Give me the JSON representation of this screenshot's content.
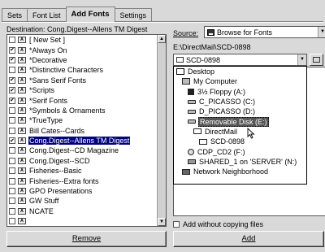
{
  "tabs": [
    "Sets",
    "Font List",
    "Add Fonts",
    "Settings"
  ],
  "active_tab": 2,
  "destination": {
    "label": "Destination: Cong.Digest--Allens TM Digest"
  },
  "font_sets": [
    {
      "label": "[ New Set ]",
      "checked": false,
      "selected": false
    },
    {
      "label": "*Always On",
      "checked": true,
      "selected": false
    },
    {
      "label": "*Decorative",
      "checked": true,
      "selected": false
    },
    {
      "label": "*Distinctive Characters",
      "checked": false,
      "selected": false
    },
    {
      "label": "*Sans Serif Fonts",
      "checked": true,
      "selected": false
    },
    {
      "label": "*Scripts",
      "checked": true,
      "selected": false
    },
    {
      "label": "*Serif Fonts",
      "checked": true,
      "selected": false
    },
    {
      "label": "*Symbols & Ornaments",
      "checked": false,
      "selected": false
    },
    {
      "label": "*TrueType",
      "checked": false,
      "selected": false
    },
    {
      "label": "Bill Cates--Cards",
      "checked": false,
      "selected": false
    },
    {
      "label": "Cong.Digest--Allens TM Digest",
      "checked": true,
      "selected": true
    },
    {
      "label": "Cong.Digest--CD Magazine",
      "checked": false,
      "selected": false
    },
    {
      "label": "Cong.Digest--SCD",
      "checked": false,
      "selected": false
    },
    {
      "label": "Fisheries--Basic",
      "checked": false,
      "selected": false
    },
    {
      "label": "Fisheries--Extra fonts",
      "checked": false,
      "selected": false
    },
    {
      "label": "GPO Presentations",
      "checked": false,
      "selected": false
    },
    {
      "label": "GW Stuff",
      "checked": false,
      "selected": false
    },
    {
      "label": "NCATE",
      "checked": false,
      "selected": false
    },
    {
      "label": "",
      "checked": false,
      "selected": false
    }
  ],
  "source": {
    "label": "Source:",
    "value": "Browse for Fonts"
  },
  "current_path": "E:\\DirectMail\\SCD-0898",
  "folder_combo": {
    "value": "SCD-0898"
  },
  "folder_tree": [
    {
      "label": "Desktop",
      "icon": "desktop",
      "indent": 0,
      "selected": false
    },
    {
      "label": "My Computer",
      "icon": "computer",
      "indent": 1,
      "selected": false
    },
    {
      "label": "3½ Floppy (A:)",
      "icon": "floppy",
      "indent": 2,
      "selected": false
    },
    {
      "label": "C_PICASSO (C:)",
      "icon": "drive",
      "indent": 2,
      "selected": false
    },
    {
      "label": "D_PICASSO (D:)",
      "icon": "drive",
      "indent": 2,
      "selected": false
    },
    {
      "label": "Removable Disk (E:)",
      "icon": "drive",
      "indent": 2,
      "selected": true
    },
    {
      "label": "DirectMail",
      "icon": "folder",
      "indent": 3,
      "selected": false
    },
    {
      "label": "SCD-0898",
      "icon": "folder",
      "indent": 4,
      "selected": false
    },
    {
      "label": "CDP_CD2 (F:)",
      "icon": "cd",
      "indent": 2,
      "selected": false
    },
    {
      "label": "SHARED_1 on 'SERVER' (N:)",
      "icon": "net",
      "indent": 2,
      "selected": false
    },
    {
      "label": "Network Neighborhood",
      "icon": "network",
      "indent": 1,
      "selected": false
    }
  ],
  "add_without_copying": {
    "label": "Add without copying files",
    "checked": false
  },
  "buttons": {
    "remove": "Remove",
    "add": "Add"
  }
}
